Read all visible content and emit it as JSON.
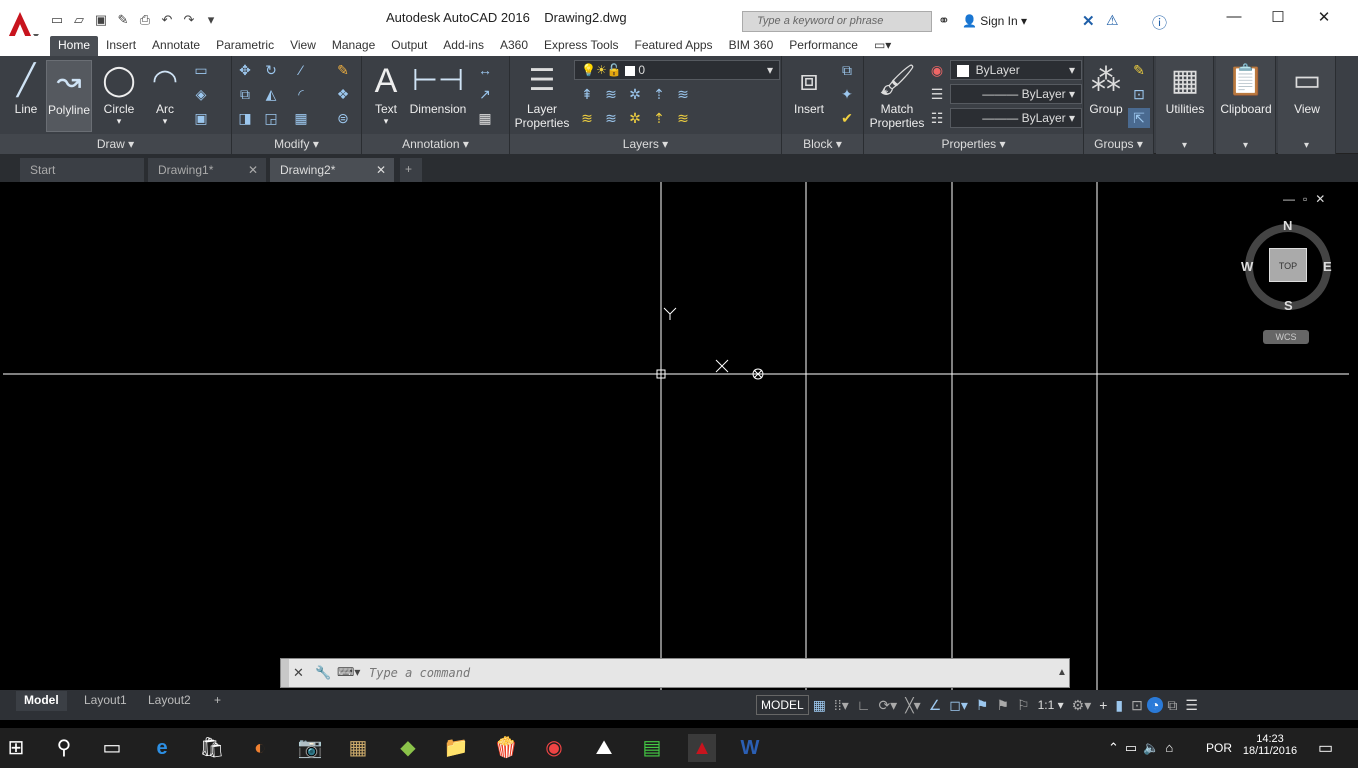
{
  "title": {
    "app": "Autodesk AutoCAD 2016",
    "file": "Drawing2.dwg"
  },
  "search": {
    "placeholder": "Type a keyword or phrase"
  },
  "account": {
    "signin": "Sign In"
  },
  "ribbon_tabs": [
    "Home",
    "Insert",
    "Annotate",
    "Parametric",
    "View",
    "Manage",
    "Output",
    "Add-ins",
    "A360",
    "Express Tools",
    "Featured Apps",
    "BIM 360",
    "Performance"
  ],
  "draw": {
    "title": "Draw",
    "line": "Line",
    "polyline": "Polyline",
    "circle": "Circle",
    "arc": "Arc"
  },
  "modify": {
    "title": "Modify"
  },
  "annotation": {
    "title": "Annotation",
    "text": "Text",
    "dimension": "Dimension"
  },
  "layers": {
    "title": "Layers",
    "layer_properties_1": "Layer",
    "layer_properties_2": "Properties",
    "current_layer": "0"
  },
  "block": {
    "title": "Block",
    "insert": "Insert"
  },
  "properties": {
    "title": "Properties",
    "match_1": "Match",
    "match_2": "Properties",
    "color": "ByLayer",
    "linetype": "ByLayer",
    "lineweight": "ByLayer"
  },
  "groups": {
    "title": "Groups",
    "group": "Group"
  },
  "utilities": {
    "label": "Utilities"
  },
  "clipboard": {
    "label": "Clipboard"
  },
  "view": {
    "label": "View"
  },
  "doc_tabs": {
    "start": "Start",
    "drawing1": "Drawing1*",
    "drawing2": "Drawing2*"
  },
  "viewcube": {
    "n": "N",
    "s": "S",
    "e": "E",
    "w": "W",
    "top": "TOP",
    "wcs": "WCS"
  },
  "ucs": {
    "x": "X",
    "y": "Y"
  },
  "command": {
    "placeholder": "Type a command"
  },
  "layout_tabs": {
    "model": "Model",
    "layout1": "Layout1",
    "layout2": "Layout2"
  },
  "status": {
    "model": "MODEL",
    "scale": "1:1"
  },
  "taskbar": {
    "lang": "POR",
    "time": "14:23",
    "date": "18/11/2016"
  }
}
